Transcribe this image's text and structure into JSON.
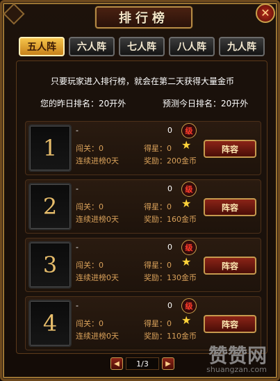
{
  "title": "排行榜",
  "close_glyph": "✕",
  "tabs": [
    {
      "label": "五人阵",
      "active": true
    },
    {
      "label": "六人阵",
      "active": false
    },
    {
      "label": "七人阵",
      "active": false
    },
    {
      "label": "八人阵",
      "active": false
    },
    {
      "label": "九人阵",
      "active": false
    }
  ],
  "notice": "只要玩家进入排行榜，就会在第二天获得大量金币",
  "yesterday_rank": "您的昨日排名：20开外",
  "today_rank": "预测今日排名：20开外",
  "rows": [
    {
      "rank": "1",
      "name": "-",
      "zero": "0",
      "level": "级",
      "pass": "闯关：0",
      "stars": "得星：0",
      "streak": "连续进榜0天",
      "reward": "奖励：200金币",
      "button": "阵容"
    },
    {
      "rank": "2",
      "name": "-",
      "zero": "0",
      "level": "级",
      "pass": "闯关：0",
      "stars": "得星：0",
      "streak": "连续进榜0天",
      "reward": "奖励：160金币",
      "button": "阵容"
    },
    {
      "rank": "3",
      "name": "-",
      "zero": "0",
      "level": "级",
      "pass": "闯关：0",
      "stars": "得星：0",
      "streak": "连续进榜0天",
      "reward": "奖励：130金币",
      "button": "阵容"
    },
    {
      "rank": "4",
      "name": "-",
      "zero": "0",
      "level": "级",
      "pass": "闯关：0",
      "stars": "得星：0",
      "streak": "连续进榜0天",
      "reward": "奖励：110金币",
      "button": "阵容"
    }
  ],
  "pager": {
    "prev": "◀",
    "next": "▶",
    "page": "1/3"
  },
  "watermark": {
    "cn": "赞赞网",
    "en": "shuangzan.com"
  },
  "colors": {
    "accent_gold": "#f5c34a",
    "label_orange": "#d9a15a",
    "button_red": "#8b2417"
  }
}
